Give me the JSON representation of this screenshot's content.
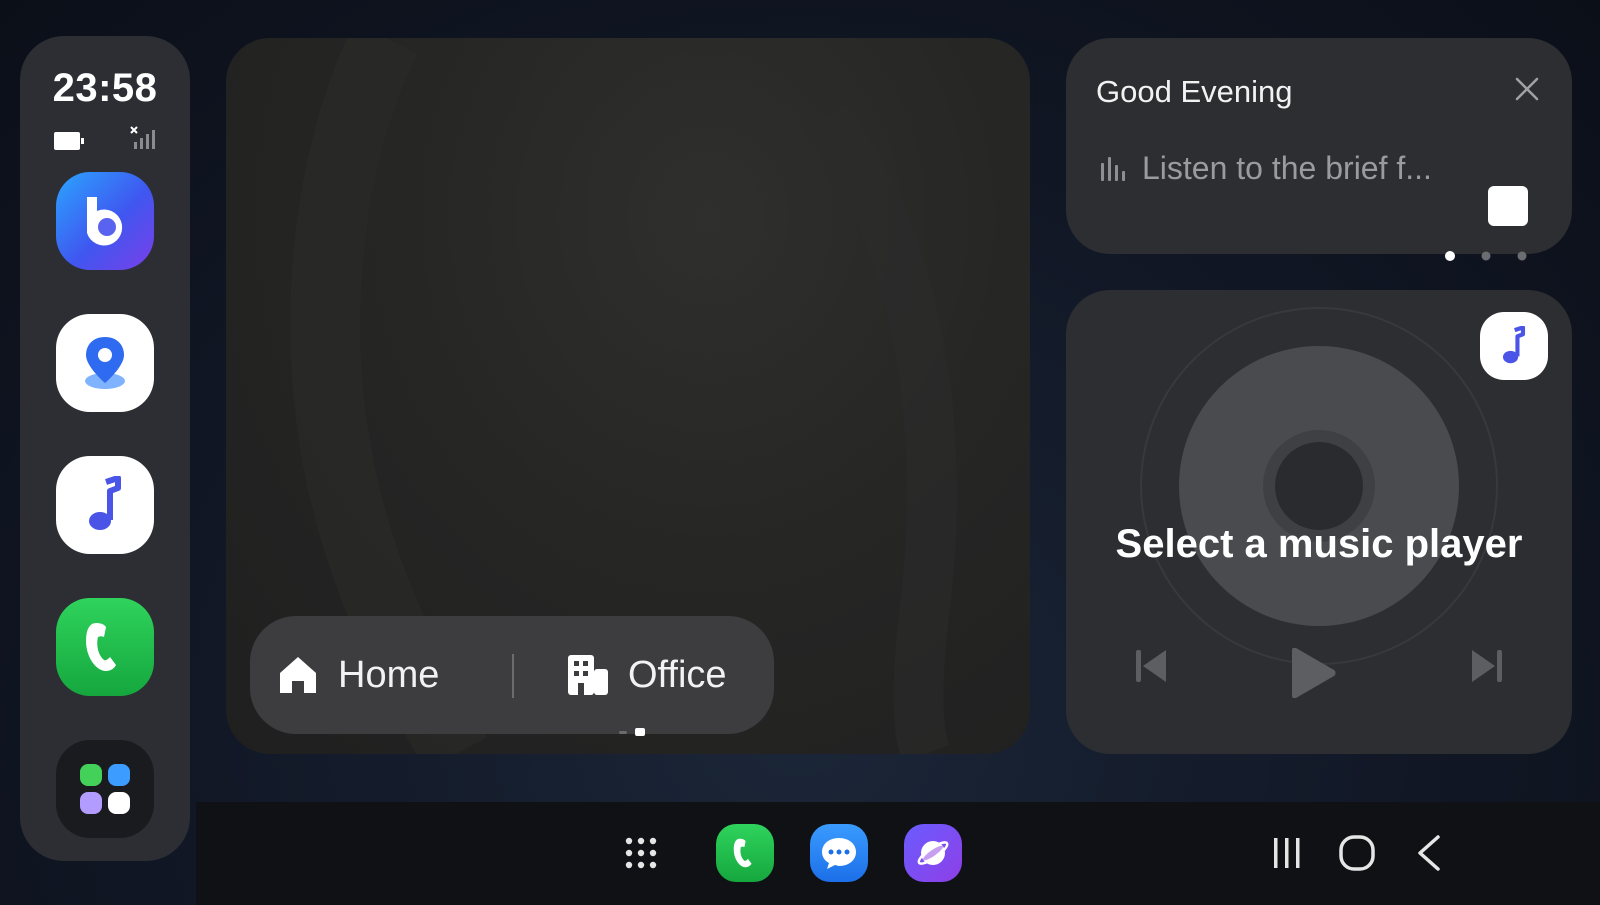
{
  "status": {
    "time": "23:58"
  },
  "rail": {
    "apps": [
      {
        "name": "bixby"
      },
      {
        "name": "maps"
      },
      {
        "name": "music"
      },
      {
        "name": "phone"
      },
      {
        "name": "app-library"
      }
    ]
  },
  "map": {
    "destinations": [
      {
        "label": "Home",
        "icon": "house-icon"
      },
      {
        "label": "Office",
        "icon": "building-icon"
      }
    ],
    "page_count": 2,
    "active_page": 2
  },
  "briefing": {
    "title": "Good Evening",
    "text": "Listen to the brief f...",
    "page_count": 3,
    "active_page": 1
  },
  "music": {
    "title": "Select a music player"
  },
  "colors": {
    "background": "#111725",
    "card": "#2d2e31",
    "accent_blue": "#4a6cf7",
    "phone_green": "#22c04b"
  }
}
